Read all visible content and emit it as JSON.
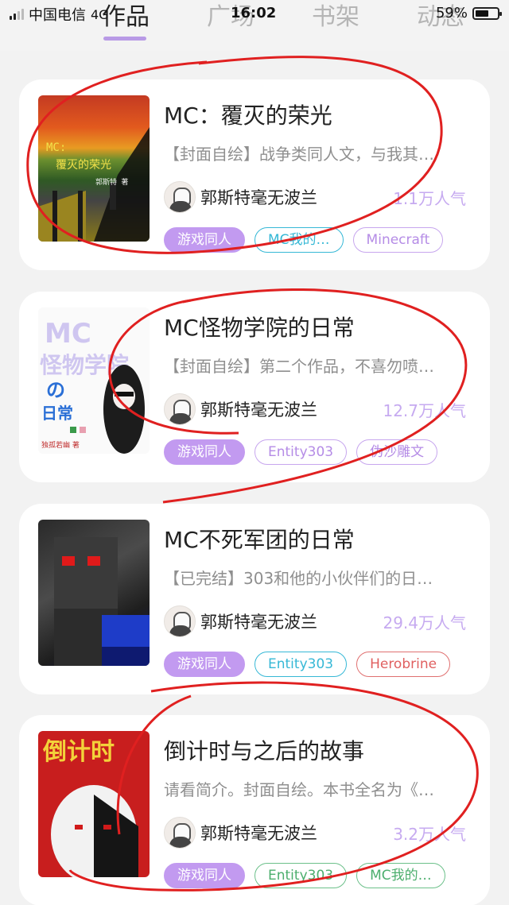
{
  "status_bar": {
    "carrier": "中国电信",
    "network": "4G",
    "time": "16:02",
    "battery": "59%"
  },
  "tabs": [
    {
      "label": "作品",
      "active": true
    },
    {
      "label": "广场",
      "active": false
    },
    {
      "label": "书架",
      "active": false
    },
    {
      "label": "动态",
      "active": false
    }
  ],
  "works": [
    {
      "title": "MC：覆灭的荣光",
      "desc": "【封面自绘】战争类同人文，与我其…",
      "author": "郭斯特毫无波兰",
      "popularity": "1.1万人气",
      "tags": [
        {
          "label": "游戏同人",
          "style": "filled"
        },
        {
          "label": "MC我的…",
          "style": "cyan"
        },
        {
          "label": "Minecraft",
          "style": "purple"
        }
      ],
      "cover_text": [
        "MC:",
        "覆灭的荣光",
        "郭斯特 著"
      ]
    },
    {
      "title": "MC怪物学院的日常",
      "desc": "【封面自绘】第二个作品，不喜勿喷…",
      "author": "郭斯特毫无波兰",
      "popularity": "12.7万人气",
      "tags": [
        {
          "label": "游戏同人",
          "style": "filled"
        },
        {
          "label": "Entity303",
          "style": "purple"
        },
        {
          "label": "伪沙雕文",
          "style": "purple"
        }
      ],
      "cover_text": [
        "MC",
        "怪物学院",
        "の",
        "日常",
        "独孤若幽 著"
      ]
    },
    {
      "title": "MC不死军团的日常",
      "desc": "【已完结】303和他的小伙伴们的日…",
      "author": "郭斯特毫无波兰",
      "popularity": "29.4万人气",
      "tags": [
        {
          "label": "游戏同人",
          "style": "filled"
        },
        {
          "label": "Entity303",
          "style": "cyan"
        },
        {
          "label": "Herobrine",
          "style": "red"
        }
      ],
      "cover_text": []
    },
    {
      "title": "倒计时与之后的故事",
      "desc": "请看简介。封面自绘。本书全名为《…",
      "author": "郭斯特毫无波兰",
      "popularity": "3.2万人气",
      "tags": [
        {
          "label": "游戏同人",
          "style": "filled"
        },
        {
          "label": "Entity303",
          "style": "green"
        },
        {
          "label": "MC我的…",
          "style": "green"
        }
      ],
      "cover_text": [
        "倒计时"
      ]
    }
  ],
  "colors": {
    "accent": "#c29af0",
    "popularity": "#c6aaf0",
    "annotation": "#e02020"
  }
}
